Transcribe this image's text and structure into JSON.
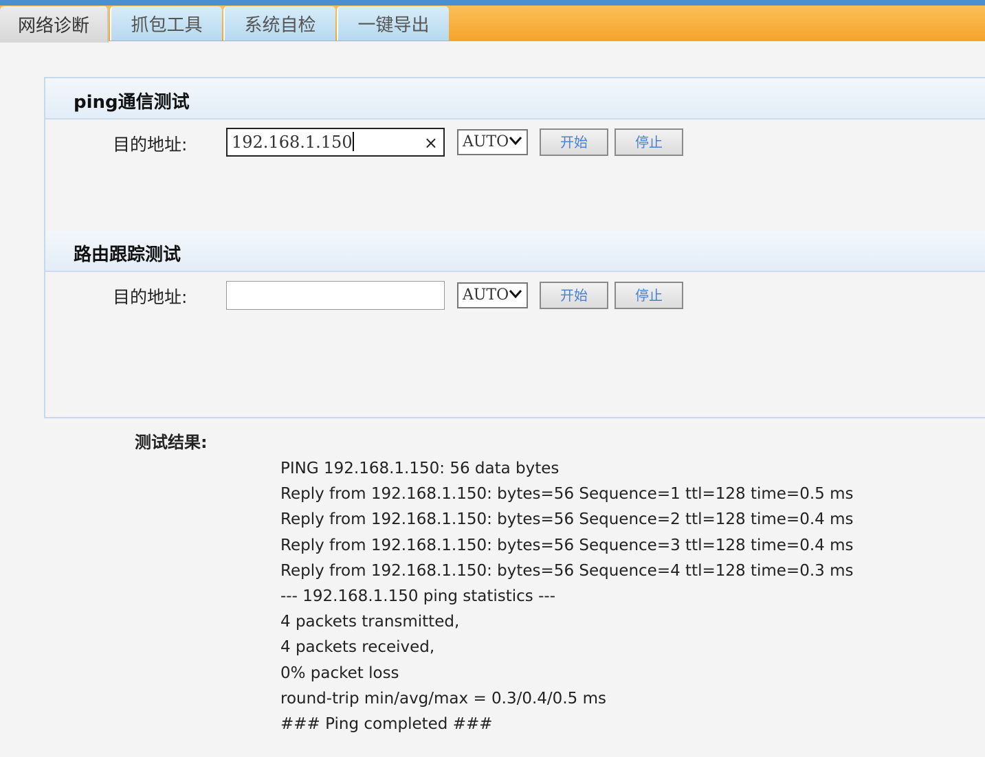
{
  "tabs": [
    {
      "label": "网络诊断",
      "active": true
    },
    {
      "label": "抓包工具",
      "active": false
    },
    {
      "label": "系统自检",
      "active": false
    },
    {
      "label": "一键导出",
      "active": false
    }
  ],
  "ping": {
    "title": "ping通信测试",
    "address_label": "目的地址:",
    "address_value": "192.168.1.150",
    "mode": "AUTO",
    "start_label": "开始",
    "stop_label": "停止"
  },
  "trace": {
    "title": "路由跟踪测试",
    "address_label": "目的地址:",
    "address_value": "",
    "mode": "AUTO",
    "start_label": "开始",
    "stop_label": "停止"
  },
  "results": {
    "label": "测试结果:",
    "lines": [
      "PING 192.168.1.150: 56 data bytes",
      "Reply from 192.168.1.150: bytes=56 Sequence=1 ttl=128 time=0.5 ms",
      "Reply from 192.168.1.150: bytes=56 Sequence=2 ttl=128 time=0.4 ms",
      "Reply from 192.168.1.150: bytes=56 Sequence=3 ttl=128 time=0.4 ms",
      "Reply from 192.168.1.150: bytes=56 Sequence=4 ttl=128 time=0.3 ms",
      "--- 192.168.1.150 ping statistics ---",
      "4 packets transmitted,",
      "4 packets received,",
      "0% packet loss",
      "round-trip min/avg/max = 0.3/0.4/0.5 ms",
      "### Ping completed ###"
    ]
  },
  "icons": {
    "clear": "×"
  },
  "colors": {
    "tab_bar_orange": "#f5a42c",
    "tab_bar_blue": "#4a8fd0",
    "button_text": "#4a7fd6"
  }
}
